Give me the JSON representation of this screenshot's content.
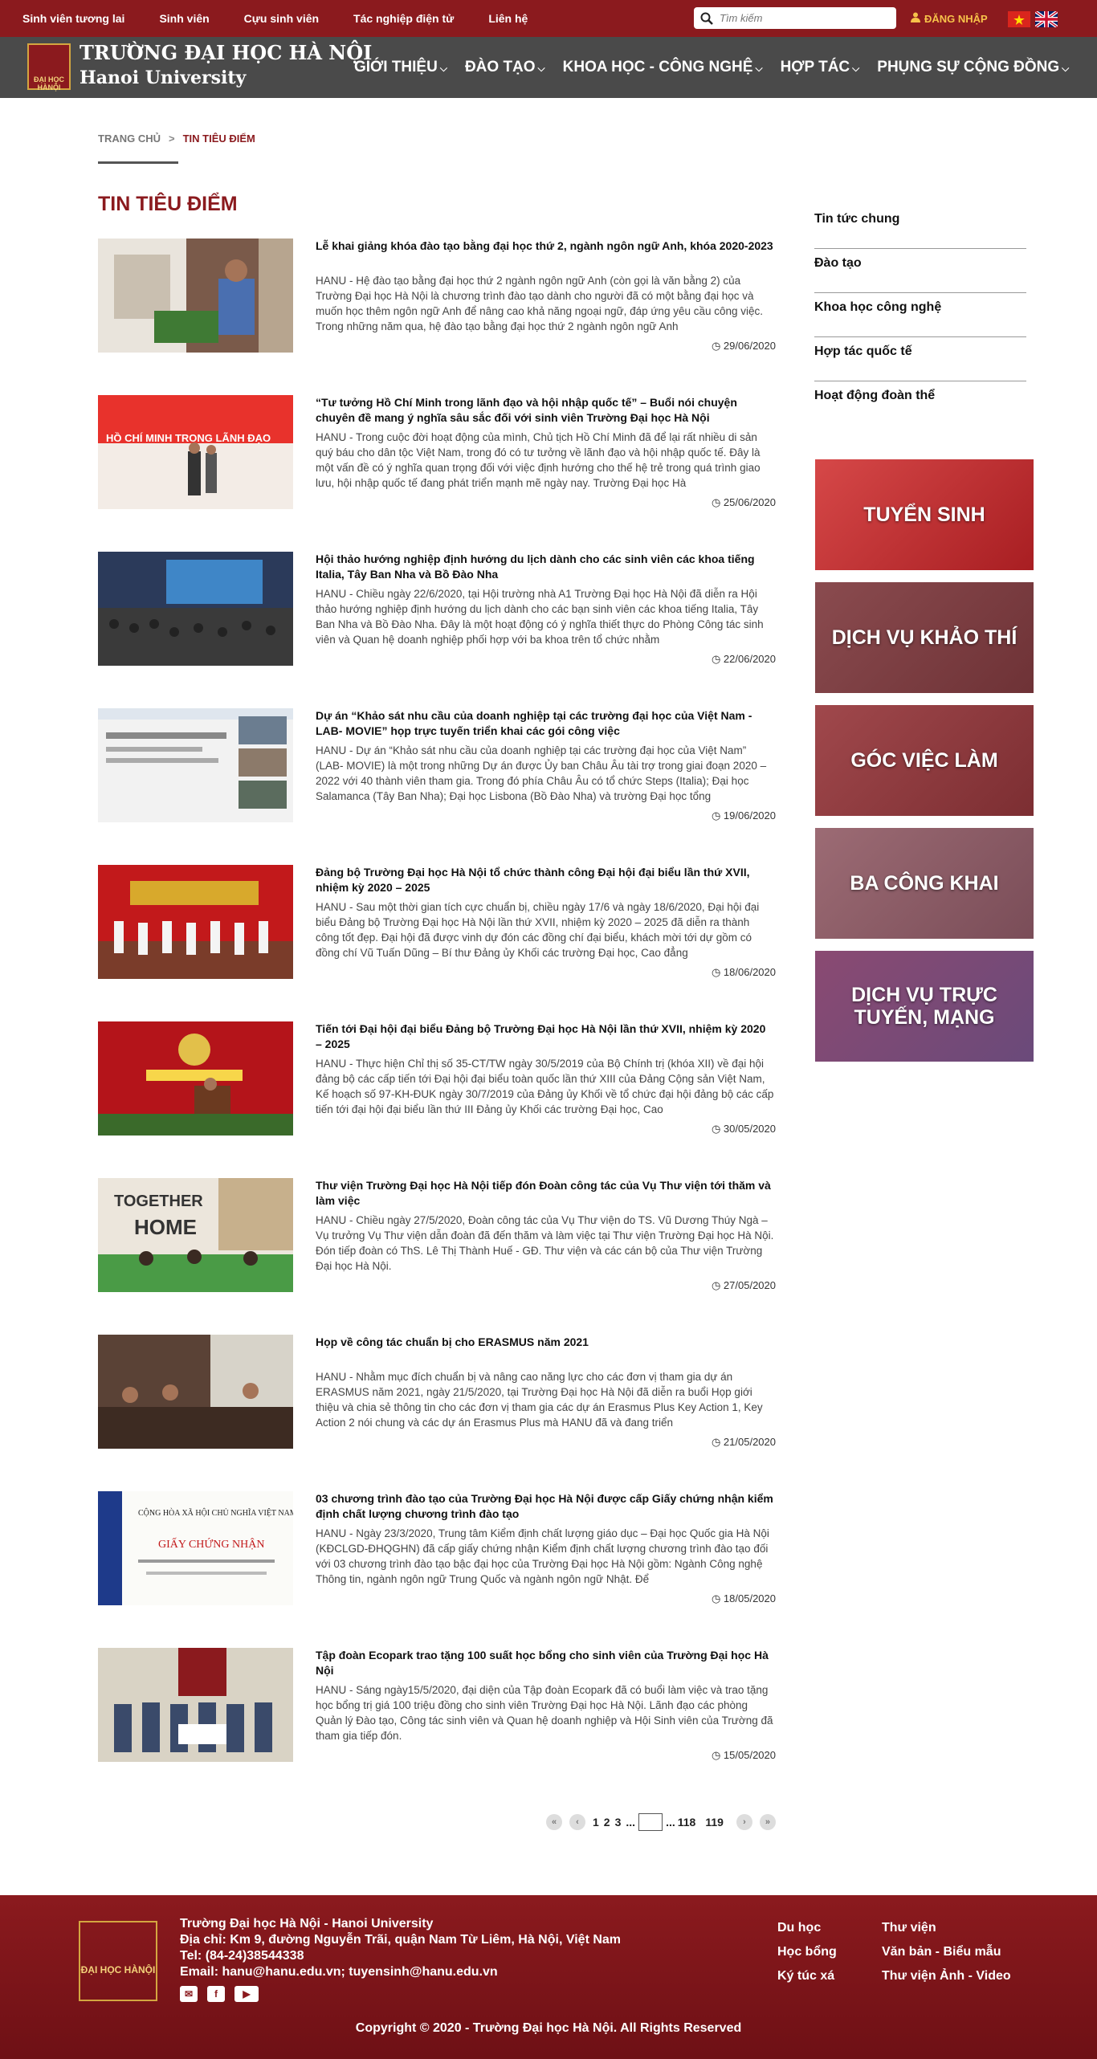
{
  "topbar": {
    "links": [
      "Sinh viên tương lai",
      "Sinh viên",
      "Cựu sinh viên",
      "Tác nghiệp điện tử",
      "Liên hệ"
    ],
    "search_placeholder": "Tìm kiếm",
    "login": "ĐĂNG NHẬP"
  },
  "header": {
    "logo_text": "ĐẠI HỌC HÀNỘI",
    "name_vi": "TRƯỜNG ĐẠI HỌC HÀ NỘI",
    "name_en": "Hanoi University",
    "nav": [
      "GIỚI THIỆU",
      "ĐÀO TẠO",
      "KHOA HỌC - CÔNG NGHỆ",
      "HỢP TÁC",
      "PHỤNG SỰ CỘNG ĐỒNG"
    ]
  },
  "breadcrumb": {
    "home": "TRANG CHỦ",
    "current": "TIN TIÊU ĐIỂM"
  },
  "page_title": "TIN TIÊU ĐIỂM",
  "articles": [
    {
      "title": "Lễ khai giảng khóa đào tạo bằng đại học thứ 2, ngành ngôn ngữ Anh, khóa 2020-2023",
      "excerpt": "HANU - Hệ đào tạo bằng đại học thứ 2 ngành ngôn ngữ Anh (còn gọi là văn bằng 2) của Trường Đại học Hà Nội là chương trình đào tạo dành cho người đã có một bằng đại học và muốn học thêm ngôn ngữ Anh để nâng cao khả năng ngoại ngữ, đáp ứng yêu cầu công việc. Trong những năm qua, hệ đào tạo bằng đại học thứ 2 ngành ngôn ngữ Anh",
      "date": "29/06/2020"
    },
    {
      "title": "“Tư tưởng Hồ Chí Minh trong lãnh đạo và hội nhập quốc tế” – Buổi nói chuyện chuyên đề mang ý nghĩa sâu sắc đối với sinh viên Trường Đại học Hà Nội",
      "excerpt": "HANU - Trong cuộc đời hoạt động của mình, Chủ tịch Hồ Chí Minh đã để lại rất nhiều di sản quý báu cho dân tộc Việt Nam, trong đó có tư tưởng về lãnh đạo và hội nhập quốc tế. Đây là một vấn đề có ý nghĩa quan trọng đối với việc định hướng cho thế hệ trẻ trong quá trình giao lưu, hội nhập quốc tế đang phát triển mạnh mẽ ngày nay. Trường Đại học Hà",
      "date": "25/06/2020"
    },
    {
      "title": "Hội thảo hướng nghiệp định hướng du lịch dành cho các sinh viên các khoa tiếng Italia, Tây Ban Nha và Bồ Đào Nha",
      "excerpt": "HANU - Chiều ngày 22/6/2020, tại Hội trường nhà A1 Trường Đại học Hà Nội đã diễn ra Hội thảo hướng nghiệp định hướng du lịch dành cho các bạn sinh viên các khoa tiếng Italia, Tây Ban Nha và Bồ Đào Nha. Đây là một hoạt động có ý nghĩa thiết thực do Phòng Công tác sinh viên và Quan hệ doanh nghiệp phối hợp với ba khoa trên tổ chức nhằm",
      "date": "22/06/2020"
    },
    {
      "title": "Dự án “Khảo sát nhu cầu của doanh nghiệp tại các trường đại học của Việt Nam - LAB- MOVIE” họp trực tuyến triển khai các gói công việc",
      "excerpt": "HANU - Dự án “Khảo sát nhu cầu của doanh nghiệp tại các trường đại học của Việt Nam” (LAB- MOVIE) là một trong những Dự án được Ủy ban Châu Âu tài trợ trong giai đoạn 2020 – 2022 với 40 thành viên tham gia. Trong đó phía Châu Âu có tổ chức Steps (Italia); Đại học Salamanca (Tây Ban Nha); Đại học Lisbona (Bồ Đào Nha) và trường Đại học tổng",
      "date": "19/06/2020"
    },
    {
      "title": "Đảng bộ Trường Đại học Hà Nội tổ chức thành công Đại hội đại biểu lần thứ XVII, nhiệm kỳ 2020 – 2025",
      "excerpt": "HANU - Sau một thời gian tích cực chuẩn bị, chiều ngày 17/6 và ngày 18/6/2020, Đại hội đại biểu Đảng bộ Trường Đại học Hà Nội lần thứ XVII, nhiệm kỳ 2020 – 2025 đã diễn ra thành công tốt đẹp. Đại hội đã được vinh dự đón các đồng chí đại biểu, khách mời tới dự gồm có đồng chí Vũ Tuấn Dũng – Bí thư Đảng ủy Khối các trường Đại học, Cao đẳng",
      "date": "18/06/2020"
    },
    {
      "title": "Tiến tới Đại hội đại biểu Đảng bộ Trường Đại học Hà Nội lần thứ XVII, nhiệm kỳ 2020 – 2025",
      "excerpt": "HANU - Thực hiện Chỉ thị số 35-CT/TW ngày 30/5/2019 của Bộ Chính trị (khóa XII) về đại hội đảng bộ các cấp tiến tới Đại hội đại biểu toàn quốc lần thứ XIII của Đảng Cộng sản Việt Nam, Kế hoạch số 97-KH-ĐUK ngày 30/7/2019 của Đảng ủy Khối về tổ chức đại hội đảng bộ các cấp tiến tới đại hội đại biểu lần thứ III Đảng ủy Khối các trường Đại học, Cao",
      "date": "30/05/2020"
    },
    {
      "title": "Thư viện Trường Đại học Hà Nội tiếp đón Đoàn công tác của Vụ Thư viện tới thăm và làm việc",
      "excerpt": "HANU - Chiều ngày 27/5/2020, Đoàn công tác của Vụ Thư viện do TS. Vũ Dương Thúy Ngà – Vụ trưởng Vụ Thư viện dẫn đoàn đã đến thăm và làm việc tại Thư viện Trường Đại học Hà Nội. Đón tiếp đoàn có ThS. Lê Thị Thành Huế - GĐ. Thư viện và các cán bộ của Thư viện Trường Đại học Hà Nội.",
      "date": "27/05/2020"
    },
    {
      "title": "Họp về công tác chuẩn bị cho ERASMUS năm 2021",
      "excerpt": "HANU - Nhằm mục đích chuẩn bị và nâng cao năng lực cho các đơn vị tham gia dự án ERASMUS năm 2021, ngày 21/5/2020, tại Trường Đại học Hà Nội đã diễn ra buổi Họp giới thiệu và chia sẻ thông tin cho các đơn vị tham gia các dự án Erasmus Plus Key Action 1, Key Action 2 nói chung và các dự án Erasmus Plus mà HANU đã và đang triển",
      "date": "21/05/2020"
    },
    {
      "title": "03 chương trình đào tạo của Trường Đại học Hà Nội được cấp Giấy chứng nhận kiểm định chất lượng chương trình đào tạo",
      "excerpt": "HANU - Ngày 23/3/2020, Trung tâm Kiểm định chất lượng giáo dục – Đại học Quốc gia Hà Nội (KĐCLGD-ĐHQGHN) đã cấp giấy chứng nhận Kiểm định chất lượng chương trình đào tạo đối với 03 chương trình đào tạo bậc đại học của Trường Đại học Hà Nội gồm: Ngành Công nghệ Thông tin, ngành ngôn ngữ Trung Quốc và ngành ngôn ngữ Nhật. Để",
      "date": "18/05/2020"
    },
    {
      "title": "Tập đoàn Ecopark trao tặng 100 suất học bổng cho sinh viên của Trường Đại học Hà Nội",
      "excerpt": "HANU - Sáng ngày15/5/2020, đại diện của Tập đoàn Ecopark đã có buổi làm việc và trao tặng học bổng trị giá 100 triệu đồng cho sinh viên Trường Đại học Hà Nội. Lãnh đạo các phòng Quản lý Đào tạo, Công tác sinh viên và Quan hệ doanh nghiệp và Hội Sinh viên của Trường đã tham gia tiếp đón.",
      "date": "15/05/2020"
    }
  ],
  "sidebar": {
    "items": [
      "Tin tức chung",
      "Đào tạo",
      "Khoa học công nghệ",
      "Hợp tác quốc tế",
      "Hoạt động đoàn thể"
    ],
    "banners": [
      "TUYỂN SINH",
      "DỊCH VỤ KHẢO THÍ",
      "GÓC VIỆC LÀM",
      "BA CÔNG KHAI",
      "DỊCH VỤ TRỰC TUYẾN, MẠNG"
    ]
  },
  "pagination": {
    "pages": [
      "1",
      "2",
      "3"
    ],
    "ellipsis1": "...",
    "ellipsis2": "...",
    "p118": "118",
    "p119": "119"
  },
  "footer": {
    "logo_text": "ĐẠI HỌC HÀNỘI",
    "line1": "Trường Đại học Hà Nội - Hanoi University",
    "line2": "Địa chỉ: Km 9, đường Nguyễn Trãi, quận Nam Từ Liêm, Hà Nội, Việt Nam",
    "line3": "Tel: (84-24)38544338",
    "line4": "Email: hanu@hanu.edu.vn; tuyensinh@hanu.edu.vn",
    "col1": [
      "Du học",
      "Học bổng",
      "Ký túc xá"
    ],
    "col2": [
      "Thư viện",
      "Văn bản - Biểu mẫu",
      "Thư viện Ảnh - Video"
    ],
    "copyright": "Copyright © 2020 - Trường Đại học Hà Nội. All Rights Reserved"
  }
}
